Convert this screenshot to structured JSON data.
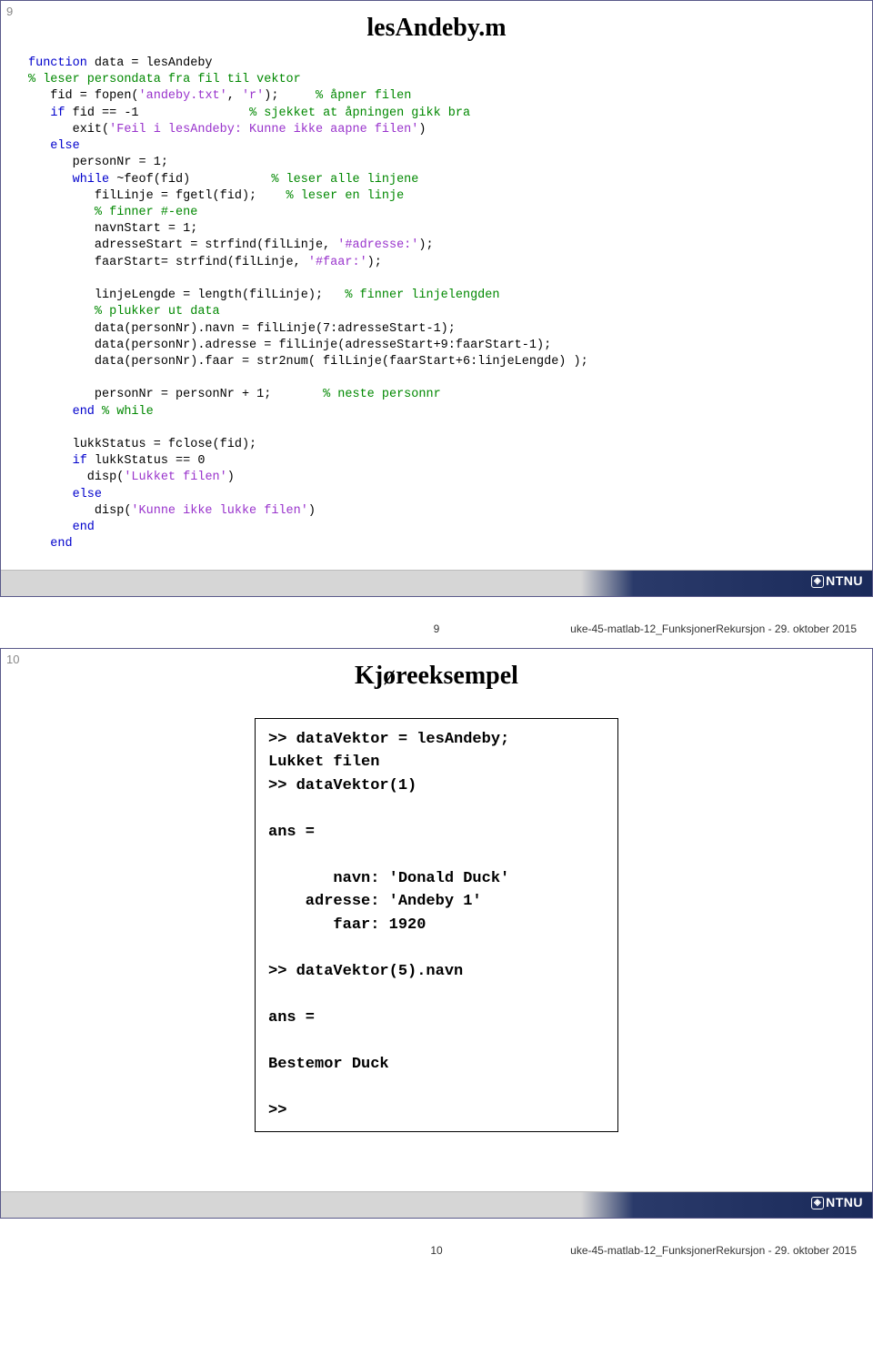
{
  "slide1": {
    "number": "9",
    "title": "lesAndeby.m",
    "code": {
      "l1a": "function",
      "l1b": " data = lesAndeby",
      "l2": "% leser persondata fra fil til vektor",
      "l3a": "   fid = fopen(",
      "l3b": "'andeby.txt'",
      "l3c": ", ",
      "l3d": "'r'",
      "l3e": ");     ",
      "l3f": "% åpner filen",
      "l4a": "   ",
      "l4b": "if",
      "l4c": " fid == -1               ",
      "l4d": "% sjekket at åpningen gikk bra",
      "l5a": "      exit(",
      "l5b": "'Feil i lesAndeby: Kunne ikke aapne filen'",
      "l5c": ")",
      "l6": "   else",
      "l7": "      personNr = 1;",
      "l8a": "      ",
      "l8b": "while",
      "l8c": " ~feof(fid)           ",
      "l8d": "% leser alle linjene",
      "l9a": "         filLinje = fgetl(fid);    ",
      "l9b": "% leser en linje",
      "l10": "         % finner #-ene",
      "l11": "         navnStart = 1;",
      "l12a": "         adresseStart = strfind(filLinje, ",
      "l12b": "'#adresse:'",
      "l12c": ");",
      "l13a": "         faarStart= strfind(filLinje, ",
      "l13b": "'#faar:'",
      "l13c": ");",
      "l14": "",
      "l15a": "         linjeLengde = length(filLinje);   ",
      "l15b": "% finner linjelengden",
      "l16": "         % plukker ut data",
      "l17": "         data(personNr).navn = filLinje(7:adresseStart-1);",
      "l18": "         data(personNr).adresse = filLinje(adresseStart+9:faarStart-1);",
      "l19": "         data(personNr).faar = str2num( filLinje(faarStart+6:linjeLengde) );",
      "l20": "",
      "l21a": "         personNr = personNr + 1;       ",
      "l21b": "% neste personnr",
      "l22a": "      ",
      "l22b": "end",
      "l22c": " ",
      "l22d": "% while",
      "l23": "",
      "l24": "      lukkStatus = fclose(fid);",
      "l25a": "      ",
      "l25b": "if",
      "l25c": " lukkStatus == 0",
      "l26a": "        disp(",
      "l26b": "'Lukket filen'",
      "l26c": ")",
      "l27": "      else",
      "l28a": "         disp(",
      "l28b": "'Kunne ikke lukke filen'",
      "l28c": ")",
      "l29": "      end",
      "l30": "   end"
    }
  },
  "slide2": {
    "number": "10",
    "title": "Kjøreeksempel",
    "console": ">> dataVektor = lesAndeby;\nLukket filen\n>> dataVektor(1)\n\nans = \n\n       navn: 'Donald Duck'\n    adresse: 'Andeby 1'\n       faar: 1920\n\n>> dataVektor(5).navn\n\nans =\n\nBestemor Duck\n\n>> "
  },
  "footer": {
    "logo": "NTNU",
    "page1": "9",
    "page2": "10",
    "meta": "uke-45-matlab-12_FunksjonerRekursjon - 29. oktober 2015"
  }
}
